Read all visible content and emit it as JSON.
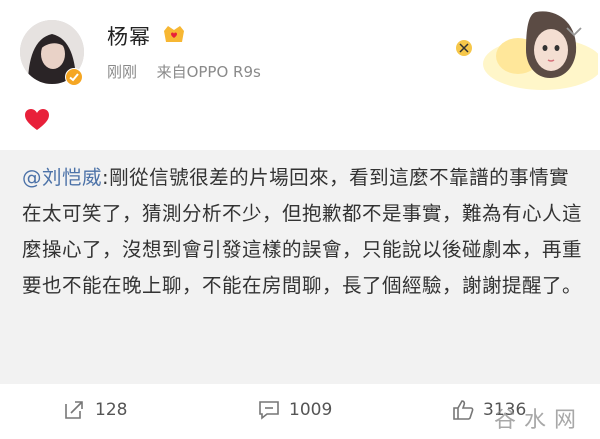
{
  "post": {
    "username": "杨幂",
    "time": "刚刚",
    "source": "来自OPPO R9s"
  },
  "quote": {
    "mention": "@刘恺威",
    "text": ":剛從信號很差的片場回來，看到這麼不靠譜的事情實在太可笑了，猜測分析不少，但抱歉都不是事實，難為有心人這麼操心了，沒想到會引發這樣的誤會，只能說以後碰劇本，再重要也不能在晚上聊，不能在房間聊，長了個經驗，謝謝提醒了。"
  },
  "actions": {
    "repost_count": "128",
    "comment_count": "1009",
    "like_count": "3136"
  },
  "watermark": "谷水网",
  "icons": [
    "verified-badge-icon",
    "vip-crown-icon",
    "chevron-down-icon",
    "heart-emoji-icon",
    "repost-icon",
    "comment-icon",
    "like-icon"
  ],
  "colors": {
    "mention": "#4c72a8",
    "quote_bg": "#f2f2f2",
    "verified": "#f5a623",
    "heart": "#e8203a"
  }
}
